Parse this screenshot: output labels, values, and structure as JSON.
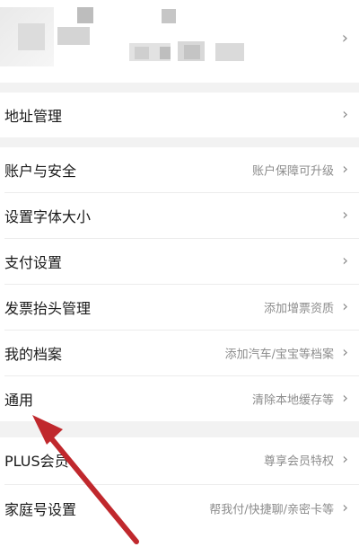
{
  "menu": {
    "items": [
      {
        "label": "地址管理",
        "hint": ""
      },
      {
        "label": "账户与安全",
        "hint": "账户保障可升级"
      },
      {
        "label": "设置字体大小",
        "hint": ""
      },
      {
        "label": "支付设置",
        "hint": ""
      },
      {
        "label": "发票抬头管理",
        "hint": "添加增票资质"
      },
      {
        "label": "我的档案",
        "hint": "添加汽车/宝宝等档案"
      },
      {
        "label": "通用",
        "hint": "清除本地缓存等"
      },
      {
        "label": "PLUS会员",
        "hint": "尊享会员特权"
      },
      {
        "label": "家庭号设置",
        "hint": "帮我付/快捷聊/亲密卡等"
      }
    ],
    "chevron": "›"
  },
  "annotation": {
    "type": "arrow",
    "color": "#c0282d",
    "target": "通用"
  }
}
